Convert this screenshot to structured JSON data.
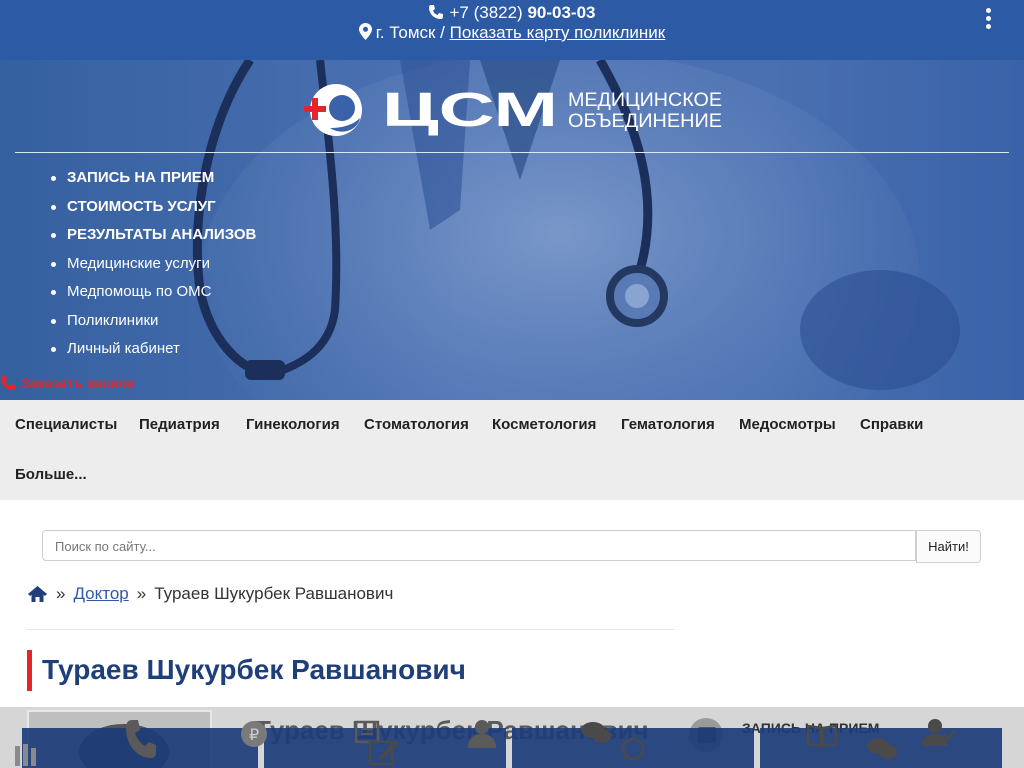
{
  "header": {
    "phone_prefix": "+7 (3822)",
    "phone_number": "90-03-03",
    "city": "г. Томск /",
    "map_link": "Показать карту поликлиник"
  },
  "logo": {
    "name": "ЦСМ",
    "line1": "МЕДИЦИНСКОЕ",
    "line2": "ОБЪЕДИНЕНИЕ"
  },
  "menu": {
    "items": [
      {
        "label": "ЗАПИСЬ НА ПРИЕМ"
      },
      {
        "label": "СТОИМОСТЬ УСЛУГ"
      },
      {
        "label": "РЕЗУЛЬТАТЫ АНАЛИЗОВ"
      },
      {
        "label": "Медицинские услуги"
      },
      {
        "label": "Медпомощь по ОМС"
      },
      {
        "label": "Поликлиники"
      },
      {
        "label": "Личный кабинет"
      }
    ],
    "callback": "Заказать звонок"
  },
  "nav": {
    "items": [
      {
        "label": "Специалисты"
      },
      {
        "label": "Педиатрия"
      },
      {
        "label": "Гинекология"
      },
      {
        "label": "Стоматология"
      },
      {
        "label": "Косметология"
      },
      {
        "label": "Гематология"
      },
      {
        "label": "Медосмотры"
      },
      {
        "label": "Справки"
      },
      {
        "label": "Больше..."
      }
    ]
  },
  "search": {
    "placeholder": "Поиск по сайту...",
    "button": "Найти!"
  },
  "breadcrumb": {
    "sep": "»",
    "link": "Доктор",
    "current": "Тураев Шукурбек Равшанович"
  },
  "page": {
    "title": "Тураев Шукурбек Равшанович",
    "peek_text": "Тураев Шукурбек Равшанович",
    "peek_record": "ЗАПИСЬ НА ПРИЕМ"
  },
  "colors": {
    "brand_blue": "#2d5aa5",
    "accent_red": "#e4262b",
    "title_blue": "#1f3f7a"
  }
}
